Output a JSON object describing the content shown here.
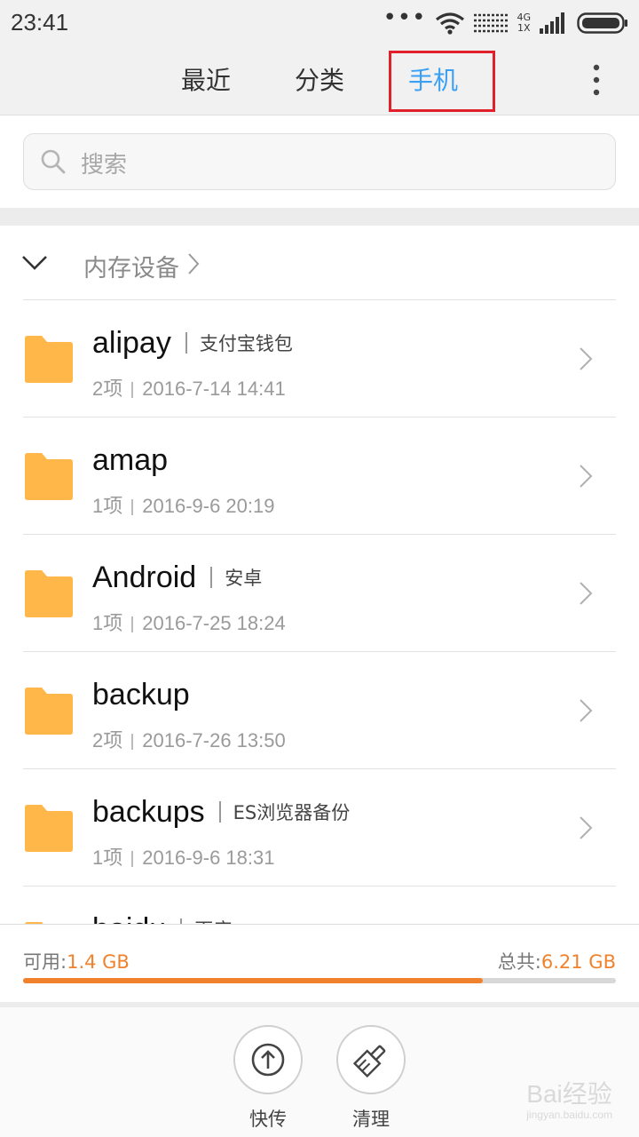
{
  "status_bar": {
    "time": "23:41",
    "network_top": "4G",
    "network_bottom": "1X"
  },
  "tabs": [
    {
      "label": "最近",
      "active": false
    },
    {
      "label": "分类",
      "active": false
    },
    {
      "label": "手机",
      "active": true
    }
  ],
  "search": {
    "placeholder": "搜索"
  },
  "breadcrumb": {
    "label": "内存设备"
  },
  "folders": [
    {
      "name": "alipay",
      "alias": "支付宝钱包",
      "count": "2项",
      "date": "2016-7-14 14:41"
    },
    {
      "name": "amap",
      "alias": "",
      "count": "1项",
      "date": "2016-9-6 20:19"
    },
    {
      "name": "Android",
      "alias": "安卓",
      "count": "1项",
      "date": "2016-7-25 18:24"
    },
    {
      "name": "backup",
      "alias": "",
      "count": "2项",
      "date": "2016-7-26 13:50"
    },
    {
      "name": "backups",
      "alias": "ES浏览器备份",
      "count": "1项",
      "date": "2016-9-6 18:31"
    },
    {
      "name": "baidu",
      "alias": "百度",
      "count": "",
      "date": ""
    }
  ],
  "storage": {
    "available_label": "可用:",
    "available_value": "1.4 GB",
    "total_label": "总共:",
    "total_value": "6.21 GB",
    "used_fraction": 0.775
  },
  "actions": [
    {
      "label": "快传",
      "icon": "upload-icon"
    },
    {
      "label": "清理",
      "icon": "broom-icon"
    }
  ],
  "watermark": {
    "text": "Bai经验",
    "sub": "jingyan.baidu.com"
  },
  "colors": {
    "accent": "#3aa0f3",
    "storage_orange": "#f0822e",
    "folder": "#ffb74a",
    "highlight": "#e0202a"
  }
}
